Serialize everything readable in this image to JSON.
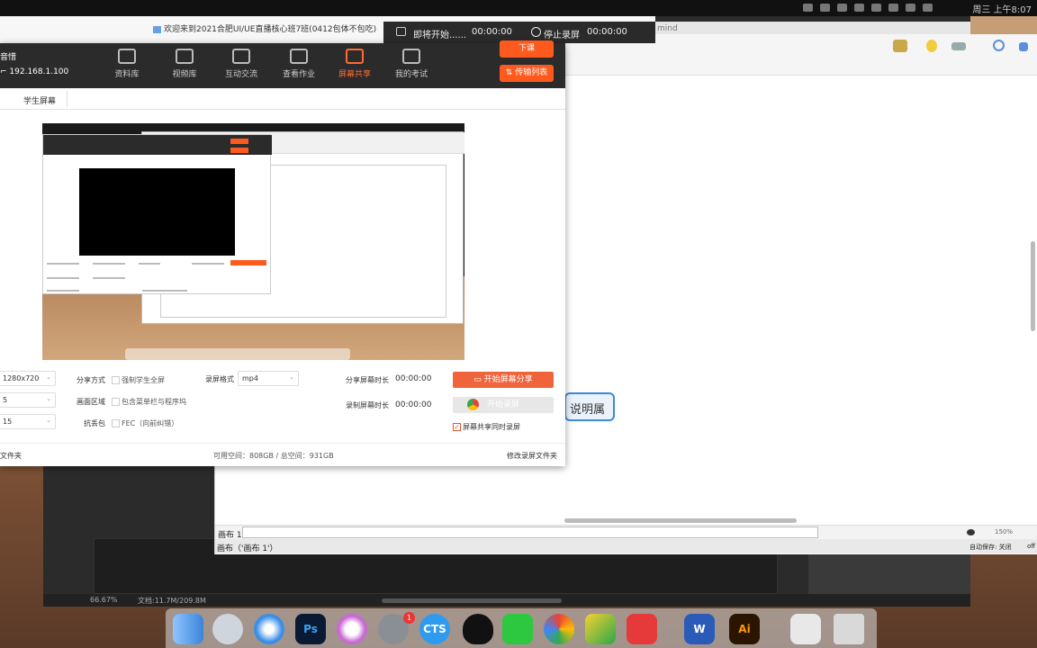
{
  "os": {
    "clock": "周三 上午8:07"
  },
  "recording": {
    "window_title": "欢迎来到2021合肥UI/UE直播核心班7班(0412包体不包吃)",
    "status_text": "即将开始......",
    "status_time": "00:00:00",
    "stop_label": "停止录屏",
    "stop_time": "00:00:00"
  },
  "app": {
    "host_name": "音惜",
    "host_ip": "192.168.1.100",
    "nav": [
      {
        "label": "资料库",
        "icon": "library-icon",
        "active": false
      },
      {
        "label": "视频库",
        "icon": "video-library-icon",
        "active": false
      },
      {
        "label": "互动交流",
        "icon": "chat-icon",
        "active": false
      },
      {
        "label": "查看作业",
        "icon": "homework-folder-icon",
        "active": false
      },
      {
        "label": "屏幕共享",
        "icon": "screen-share-icon",
        "active": true
      },
      {
        "label": "我的考试",
        "icon": "exam-icon",
        "active": false
      }
    ],
    "exit_class_label": "下课",
    "transfer_list_label": "⇅ 传输列表",
    "tab_label": "学生屏幕"
  },
  "settings": {
    "resolution_value": "1280x720",
    "fps_value": "5",
    "quality_value": "15",
    "share_mode_label": "分享方式",
    "share_mode_option": "强制学生全屏",
    "region_label": "画面区域",
    "region_option": "包含菜单栏与程序坞",
    "loss_label": "抗丢包",
    "loss_option": "FEC（向前纠错）",
    "format_label": "录屏格式",
    "format_value": "mp4",
    "share_duration_label": "分享屏幕时长",
    "share_duration_value": "00:00:00",
    "record_duration_label": "录制屏幕时长",
    "record_duration_value": "00:00:00",
    "start_share_label": "开始屏幕分享",
    "start_record_label": "开始录屏",
    "sync_record_label": "屏幕共享同时录屏",
    "sync_record_checked": true
  },
  "footer": {
    "folder_label": "文件夹",
    "space_text": "可用空间：808GB / 总空间：931GB",
    "change_folder_label": "修改录屏文件夹"
  },
  "doc": {
    "title_partial": "mind",
    "callout_text": "说明属性",
    "canvas_label": "画布 1",
    "zoom_text": "150%",
    "status_left": "画布（'画布 1'）",
    "autosave_text": "自动保存: 关闭",
    "status_right": "off"
  },
  "editor": {
    "zoom_text": "66.67%",
    "doc_size_text": "文档:11.7M/209.8M"
  },
  "dock": {
    "apps": [
      "finder-icon",
      "launchpad-icon",
      "safari-icon",
      "photoshop-icon",
      "itunes-icon",
      "system-preferences-icon",
      "cts-icon",
      "qq-icon",
      "wechat-icon",
      "screen-share-app-icon",
      "google-drive-icon",
      "xmind-icon",
      "word-icon",
      "illustrator-icon",
      "preview-icon",
      "trash-icon"
    ],
    "ps_label": "Ps",
    "cts_label": "CTS",
    "word_label": "W",
    "ai_label": "Ai",
    "badge": "1"
  },
  "colors": {
    "accent": "#ff5a1e",
    "start_button": "#f0643c",
    "callout_border": "#3b8bd6"
  }
}
